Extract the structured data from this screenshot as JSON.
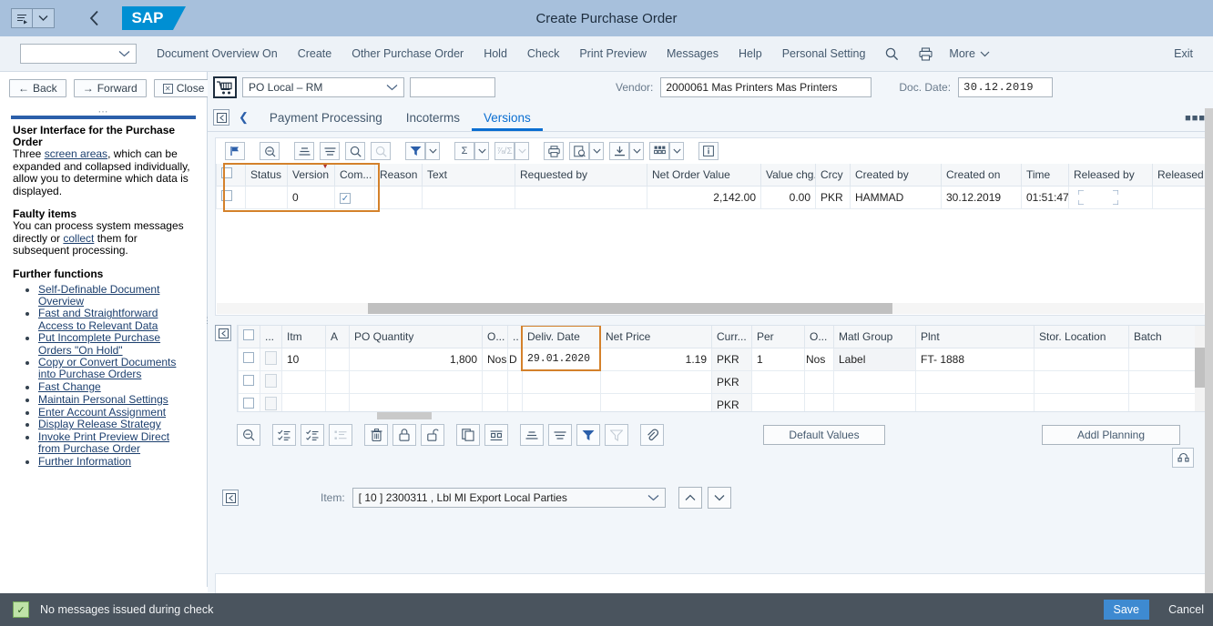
{
  "shellbar": {
    "title": "Create Purchase Order",
    "menu_icon": "menu-list-icon",
    "dropdown_icon": "chevron-down-icon",
    "back_icon": "chevron-left-icon",
    "logo_text": "SAP"
  },
  "menubar": {
    "select_value": "",
    "items": [
      "Document Overview On",
      "Create",
      "Other Purchase Order",
      "Hold",
      "Check",
      "Print Preview",
      "Messages",
      "Help",
      "Personal Setting"
    ],
    "search_icon": "search-icon",
    "print_icon": "printer-icon",
    "more_label": "More",
    "exit_label": "Exit"
  },
  "left_panel": {
    "nav": {
      "back": "Back",
      "forward": "Forward",
      "close": "Close"
    },
    "help": {
      "title": "User Interface for the Purchase Order",
      "intro_prefix": "Three ",
      "intro_link": "screen areas",
      "intro_suffix": ", which can be expanded and collapsed individually, allow you to determine which data is displayed.",
      "faulty_heading": "Faulty items",
      "faulty_prefix": "You can process system messages directly or ",
      "faulty_link": "collect",
      "faulty_suffix": " them for subsequent processing.",
      "further_heading": "Further functions",
      "links": [
        "Self-Definable Document Overview",
        "Fast and Straightforward Access to Relevant Data",
        "Put Incomplete Purchase Orders \"On Hold\"",
        "Copy or Convert Documents into Purchase Orders",
        "Fast Change",
        "Maintain Personal Settings",
        "Enter Account Assignment",
        "Display Release Strategy",
        "Invoke Print Preview Direct from Purchase Order",
        "Further Information"
      ]
    }
  },
  "header_form": {
    "cart_icon": "shopping-cart-icon",
    "po_type": "PO Local – RM",
    "po_number": "",
    "vendor_label": "Vendor:",
    "vendor_value": "2000061 Mas Printers Mas Printers",
    "docdate_label": "Doc. Date:",
    "docdate_value": "30.12.2019"
  },
  "tabs": {
    "prev_icon": "chevron-left-icon",
    "items": [
      {
        "label": "Payment Processing",
        "active": false
      },
      {
        "label": "Incoterms",
        "active": false
      },
      {
        "label": "Versions",
        "active": true
      }
    ],
    "more_icon": "overflow-dots-icon"
  },
  "versions_toolbar": [
    {
      "icon": "flag-icon",
      "disabled": false
    },
    {
      "icon": "search-detail-icon",
      "disabled": false
    },
    {
      "icon": "sort-ascending-icon",
      "disabled": false
    },
    {
      "icon": "sort-descending-icon",
      "disabled": false
    },
    {
      "icon": "find-icon",
      "disabled": false
    },
    {
      "icon": "find-next-icon",
      "disabled": true
    },
    {
      "icon": "filter-icon",
      "disabled": false
    },
    {
      "icon": "sum-icon",
      "disabled": false
    },
    {
      "icon": "subtotal-icon",
      "disabled": true
    },
    {
      "icon": "printer-icon",
      "disabled": false
    },
    {
      "icon": "print-preview-icon",
      "disabled": false
    },
    {
      "icon": "export-icon",
      "disabled": false
    },
    {
      "icon": "settings-grid-icon",
      "disabled": false
    },
    {
      "icon": "info-icon",
      "disabled": false
    }
  ],
  "versions_table": {
    "columns": [
      "Status",
      "Version",
      "Com...",
      "Reason",
      "Text",
      "Requested by",
      "Net Order Value",
      "Value chg.",
      "Crcy",
      "Created by",
      "Created on",
      "Time",
      "Released by",
      "Released on"
    ],
    "sort_indicator_column": "Version",
    "rows": [
      {
        "status": "",
        "version": "0",
        "completed": true,
        "reason": "",
        "text": "",
        "requested_by": "",
        "net_order_value": "2,142.00",
        "value_chg": "0.00",
        "crcy": "PKR",
        "created_by": "HAMMAD",
        "created_on": "30.12.2019",
        "time": "01:51:47",
        "released_by": "",
        "released_on": ""
      }
    ]
  },
  "items_table": {
    "columns": [
      "",
      "...",
      "Itm",
      "A",
      "PO Quantity",
      "O...",
      "..",
      "Deliv. Date",
      "Net Price",
      "Curr...",
      "Per",
      "O...",
      "Matl Group",
      "Plnt",
      "Stor. Location",
      "Batch"
    ],
    "settings_icon": "gear-icon",
    "rows": [
      {
        "itm": "10",
        "a": "",
        "po_quantity": "1,800",
        "ou": "Nos",
        "d": "D",
        "deliv_date": "29.01.2020",
        "net_price": "1.19",
        "curr": "PKR",
        "per": "1",
        "ou2": "Nos",
        "matl_group": "Label",
        "plnt": "FT- 1888",
        "stor_location": "",
        "batch": ""
      },
      {
        "itm": "",
        "a": "",
        "po_quantity": "",
        "ou": "",
        "d": "",
        "deliv_date": "",
        "net_price": "",
        "curr": "PKR",
        "per": "",
        "ou2": "",
        "matl_group": "",
        "plnt": "",
        "stor_location": "",
        "batch": ""
      },
      {
        "itm": "",
        "a": "",
        "po_quantity": "",
        "ou": "",
        "d": "",
        "deliv_date": "",
        "net_price": "",
        "curr": "PKR",
        "per": "",
        "ou2": "",
        "matl_group": "",
        "plnt": "",
        "stor_location": "",
        "batch": ""
      }
    ]
  },
  "items_toolbar": [
    {
      "icon": "search-detail-icon",
      "disabled": false
    },
    {
      "icon": "select-all-icon",
      "disabled": false
    },
    {
      "icon": "checklist-icon",
      "disabled": false
    },
    {
      "icon": "list-icon",
      "disabled": true
    },
    {
      "icon": "delete-icon",
      "disabled": false
    },
    {
      "icon": "lock-icon",
      "disabled": false
    },
    {
      "icon": "unlock-icon",
      "disabled": false
    },
    {
      "icon": "copy-icon",
      "disabled": false
    },
    {
      "icon": "insert-row-icon",
      "disabled": false
    },
    {
      "icon": "sort-ascending-icon",
      "disabled": false
    },
    {
      "icon": "sort-descending-icon",
      "disabled": false
    },
    {
      "icon": "filter-icon",
      "disabled": false
    },
    {
      "icon": "filter-clear-icon",
      "disabled": true
    },
    {
      "icon": "attachment-icon",
      "disabled": false
    }
  ],
  "item_buttons": {
    "default_values": "Default Values",
    "addl_planning": "Addl Planning",
    "expand_icon": "expand-collapse-icon"
  },
  "item_footer": {
    "label": "Item:",
    "value": "[ 10 ] 2300311 , Lbl MI Export Local Parties",
    "up_icon": "chevron-up-icon",
    "down_icon": "chevron-down-icon"
  },
  "status_bar": {
    "icon": "success-check-icon",
    "message": "No messages issued during check",
    "save_label": "Save",
    "cancel_label": "Cancel"
  },
  "colors": {
    "shell_bg": "#a7c0dc",
    "sap_blue": "#008fd3",
    "accent_tab": "#0a6ed1",
    "highlight_orange": "#d4812b",
    "status_bg": "#4a545e",
    "save_btn": "#3e8ad1",
    "success_green": "#bfe3a8"
  }
}
